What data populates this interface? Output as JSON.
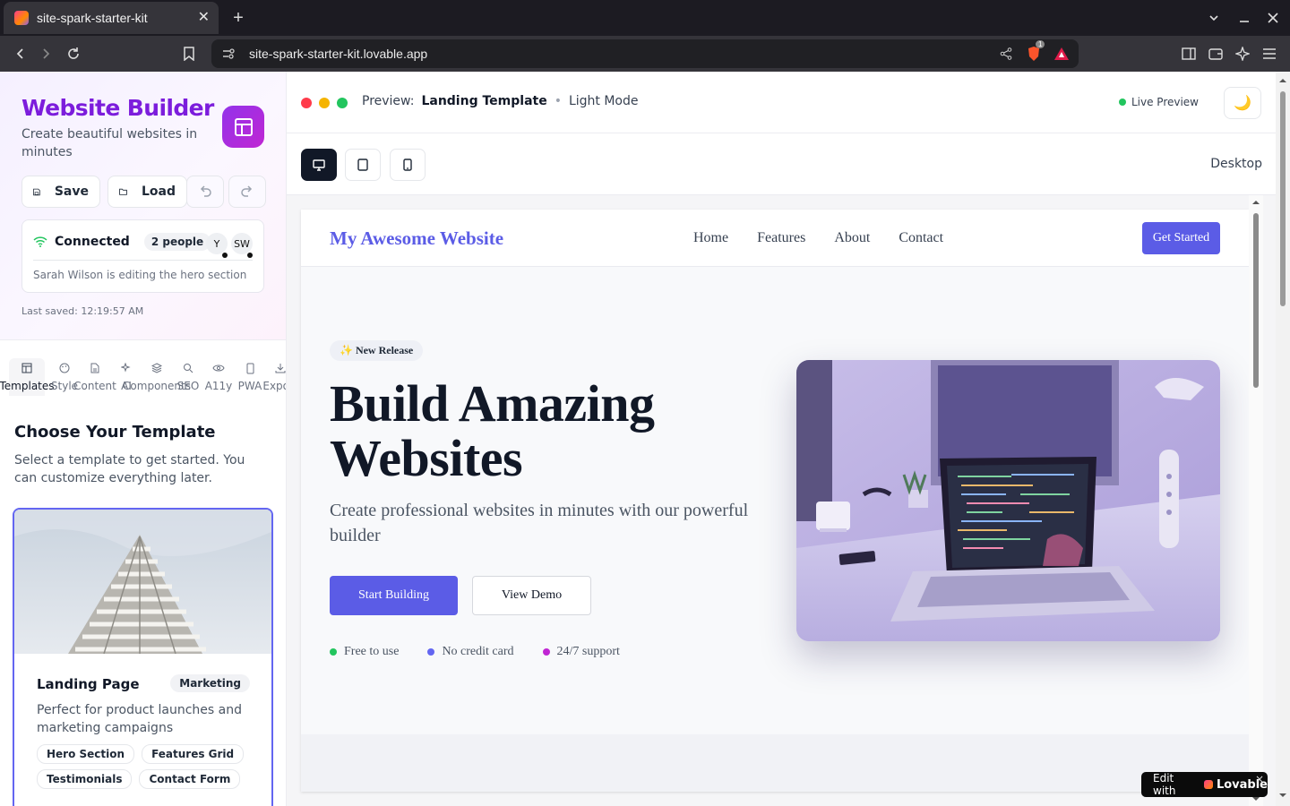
{
  "browser": {
    "tab_title": "site-spark-starter-kit",
    "url": "site-spark-starter-kit.lovable.app",
    "shield_count": "1"
  },
  "sidebar": {
    "title": "Website Builder",
    "subtitle": "Create beautiful websites in minutes",
    "save_label": "Save",
    "load_label": "Load",
    "collab": {
      "status": "Connected",
      "people": "2 people",
      "avatars": [
        "Y",
        "SW"
      ],
      "activity": "Sarah Wilson is editing the hero section"
    },
    "last_saved": "Last saved: 12:19:57 AM",
    "tools": [
      {
        "label": "Templates",
        "icon": "layout-icon"
      },
      {
        "label": "Style",
        "icon": "palette-icon"
      },
      {
        "label": "Content",
        "icon": "file-text-icon"
      },
      {
        "label": "AI",
        "icon": "sparkles-icon"
      },
      {
        "label": "Components",
        "icon": "layers-icon"
      },
      {
        "label": "SEO",
        "icon": "search-icon"
      },
      {
        "label": "A11y",
        "icon": "eye-icon"
      },
      {
        "label": "PWA",
        "icon": "smartphone-icon"
      },
      {
        "label": "Export",
        "icon": "download-icon"
      }
    ],
    "choose_title": "Choose Your Template",
    "choose_subtitle": "Select a template to get started. You can customize everything later.",
    "template": {
      "name": "Landing Page",
      "category": "Marketing",
      "description": "Perfect for product launches and marketing campaigns",
      "tags": [
        "Hero Section",
        "Features Grid",
        "Testimonials",
        "Contact Form"
      ]
    }
  },
  "preview": {
    "label": "Preview:",
    "template_name": "Landing Template",
    "separator": "•",
    "mode": "Light Mode",
    "live_label": "Live Preview",
    "device_label": "Desktop",
    "theme_icon": "🌙"
  },
  "site": {
    "logo": "My Awesome Website",
    "nav": [
      "Home",
      "Features",
      "About",
      "Contact"
    ],
    "cta": "Get Started",
    "badge": "✨ New Release",
    "hero_title": "Build Amazing Websites",
    "hero_subtitle": "Create professional websites in minutes with our powerful builder",
    "primary_button": "Start Building",
    "secondary_button": "View Demo",
    "features": [
      {
        "label": "Free to use",
        "color": "#22c55e"
      },
      {
        "label": "No credit card",
        "color": "#6366f1"
      },
      {
        "label": "24/7 support",
        "color": "#c026d3"
      }
    ]
  },
  "lovable_badge": {
    "prefix": "Edit with",
    "brand": "Lovable",
    "close": "×"
  },
  "colors": {
    "brand_purple": "#7c1ddc",
    "accent_indigo": "#5b5ce6",
    "traffic_red": "#ff3b4b",
    "traffic_yellow": "#f5b400",
    "traffic_green": "#22c55e"
  }
}
